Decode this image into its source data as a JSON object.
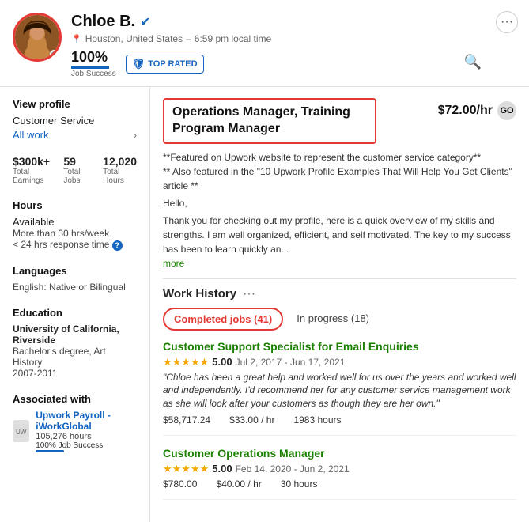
{
  "profile": {
    "name": "Chloe B.",
    "verified": true,
    "location": "Houston, United States",
    "local_time": "6:59 pm local time",
    "job_success_pct": "100%",
    "job_success_label": "Job Success",
    "badge_label": "TOP RATED",
    "more_btn_label": "···"
  },
  "sidebar": {
    "view_profile_label": "View profile",
    "category_label": "Customer Service",
    "all_work_label": "All work",
    "total_earnings": "$300k+",
    "total_earnings_label": "Total Earnings",
    "total_jobs": "59",
    "total_jobs_label": "Total Jobs",
    "total_hours": "12,020",
    "total_hours_label": "Total Hours",
    "hours_section_label": "Hours",
    "hours_availability": "Available",
    "hours_per_week": "More than 30 hrs/week",
    "response_time": "< 24 hrs response time",
    "languages_label": "Languages",
    "language_val": "English: Native or Bilingual",
    "education_label": "Education",
    "university": "University of California, Riverside",
    "degree": "Bachelor's degree, Art History",
    "years": "2007-2011",
    "associated_label": "Associated with",
    "assoc_company": "Upwork Payroll - iWorkGlobal",
    "assoc_hours": "105,276 hours",
    "assoc_success": "100% Job Success"
  },
  "main": {
    "job_title": "Operations Manager, Training Program Manager",
    "rate": "$72.00/hr",
    "go_btn": "GO",
    "bio_line1": "**Featured on Upwork website to represent the customer service category**",
    "bio_line2": "** Also featured in the \"10 Upwork Profile Examples That Will Help You Get Clients\" article **",
    "bio_hello": "Hello,",
    "bio_body": "Thank you for checking out my profile, here is a quick overview of my skills and strengths. I am well organized, efficient, and self motivated. The key to my success has been to learn quickly an...",
    "more_label": "more",
    "work_history_label": "Work History",
    "tab_completed": "Completed jobs (41)",
    "tab_in_progress": "In progress (18)",
    "jobs": [
      {
        "title": "Customer Support Specialist for Email Enquiries",
        "rating": "5.00",
        "date_range": "Jul 2, 2017 - Jun 17, 2021",
        "review": "\"Chloe has been a great help and worked well for us over the years and worked well and independently. I'd recommend her for any customer service management work as she will look after your customers as though they are her own.\"",
        "earnings": "$58,717.24",
        "rate": "$33.00 / hr",
        "hours": "1983 hours"
      },
      {
        "title": "Customer Operations Manager",
        "rating": "5.00",
        "date_range": "Feb 14, 2020 - Jun 2, 2021",
        "review": "",
        "earnings": "$780.00",
        "rate": "$40.00 / hr",
        "hours": "30 hours"
      }
    ]
  }
}
